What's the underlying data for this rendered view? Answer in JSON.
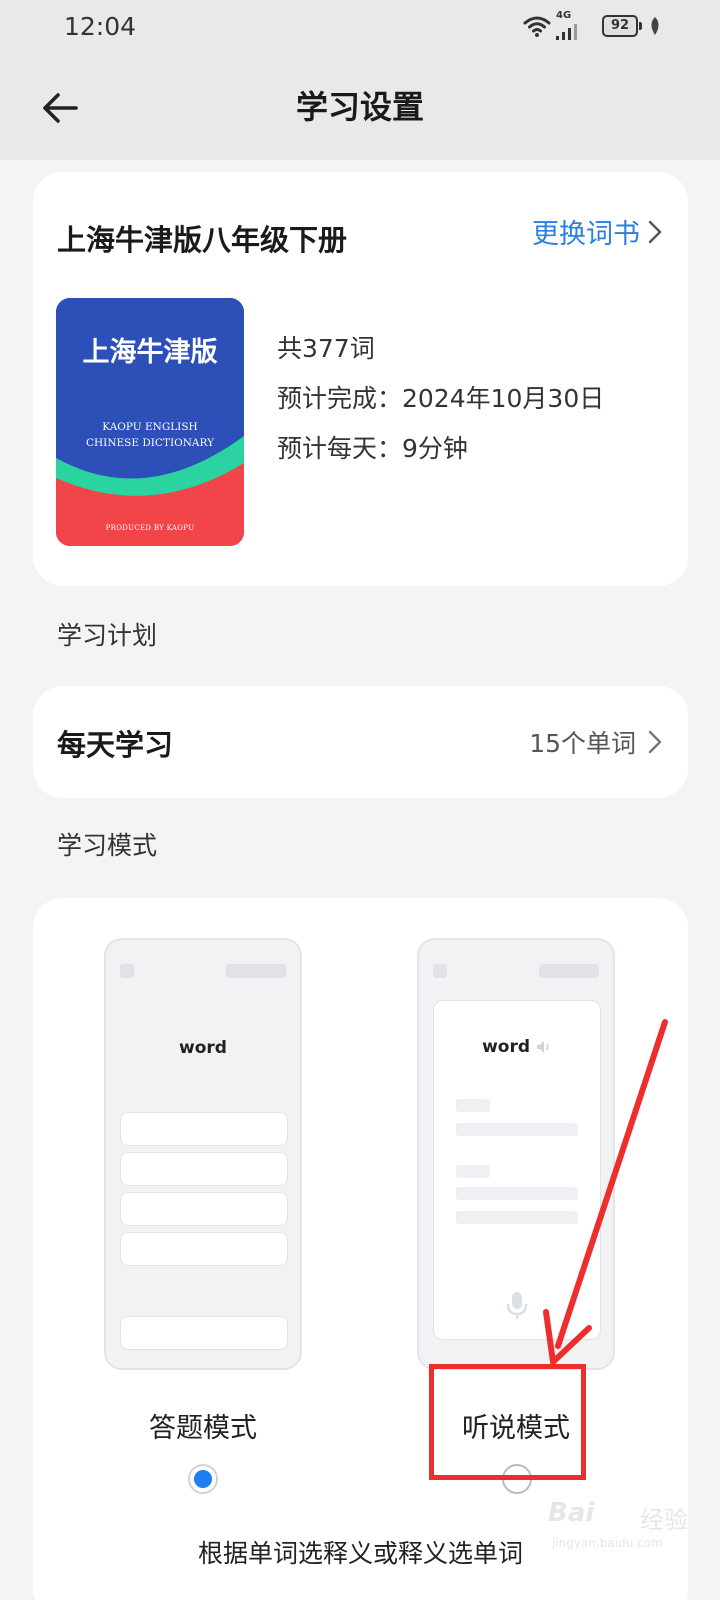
{
  "status_bar": {
    "time": "12:04",
    "network": "4G",
    "battery": "92",
    "icons": [
      "wifi-icon",
      "signal-icon",
      "battery-icon",
      "leaf-icon"
    ]
  },
  "header": {
    "title": "学习设置",
    "back_icon": "arrow-left-icon"
  },
  "book": {
    "name": "上海牛津版八年级下册",
    "change_label": "更换词书",
    "cover": {
      "title": "上海牛津版",
      "subtitle_line1": "KAOPU ENGLISH",
      "subtitle_line2": "CHINESE DICTIONARY",
      "footer": "PRODUCED BY KAOPU",
      "colors": {
        "top": "#2d4fb8",
        "wave": "#2bd3a0",
        "bottom": "#f2454a"
      }
    },
    "info": {
      "total_words": "共377词",
      "expected_finish": "预计完成：2024年10月30日",
      "daily_time": "预计每天：9分钟"
    }
  },
  "plan": {
    "section_label": "学习计划",
    "title": "每天学习",
    "value": "15个单词"
  },
  "mode": {
    "section_label": "学习模式",
    "options": [
      {
        "label": "答题模式",
        "mock_word": "word",
        "selected": true
      },
      {
        "label": "听说模式",
        "mock_word": "word",
        "selected": false
      }
    ],
    "description": "根据单词选释义或释义选单词"
  },
  "watermark": {
    "brand": "Bai",
    "brand_cn": "经验",
    "url": "jingyan.baidu.com"
  },
  "colors": {
    "accent": "#2a7fe0",
    "radio_selected": "#1e7ef2",
    "annotation": "#ee2d2d"
  }
}
